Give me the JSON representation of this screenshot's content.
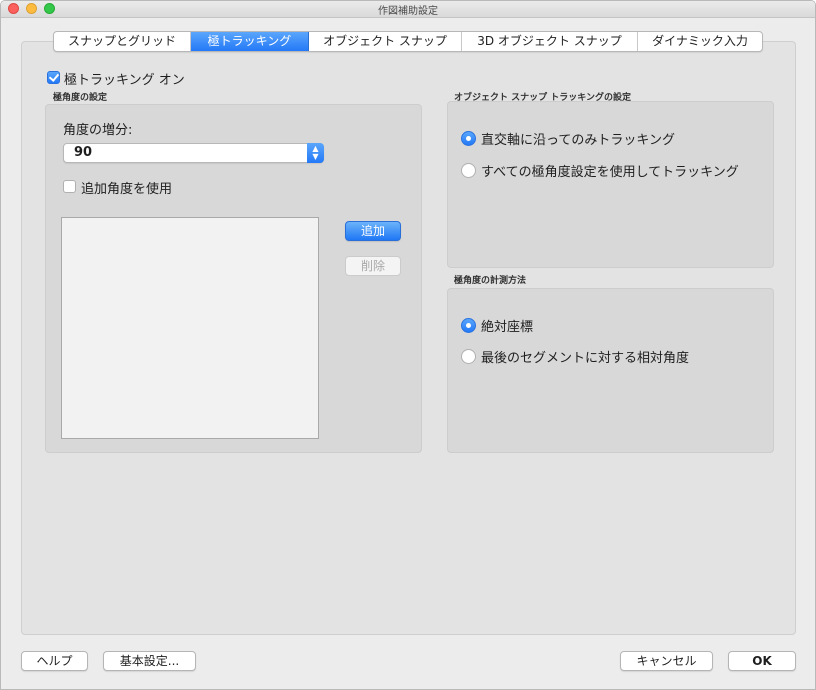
{
  "window": {
    "title": "作図補助設定"
  },
  "tabs": [
    {
      "label": "スナップとグリッド",
      "active": false
    },
    {
      "label": "極トラッキング",
      "active": true
    },
    {
      "label": "オブジェクト スナップ",
      "active": false
    },
    {
      "label": "3D オブジェクト スナップ",
      "active": false
    },
    {
      "label": "ダイナミック入力",
      "active": false
    }
  ],
  "polar": {
    "enable_label": "極トラッキング オン",
    "enabled": true,
    "angle_group_title": "極角度の設定",
    "increment_label": "角度の増分:",
    "increment_value": "90",
    "additional_label": "追加角度を使用",
    "additional_checked": false,
    "add_button": "追加",
    "delete_button": "削除"
  },
  "osnap_tracking": {
    "group_title": "オブジェクト スナップ トラッキングの設定",
    "option_orthogonal": "直交軸に沿ってのみトラッキング",
    "option_all": "すべての極角度設定を使用してトラッキング",
    "selected": "orthogonal"
  },
  "measurement": {
    "group_title": "極角度の計測方法",
    "option_absolute": "絶対座標",
    "option_relative": "最後のセグメントに対する相対角度",
    "selected": "absolute"
  },
  "footer": {
    "help": "ヘルプ",
    "options": "基本設定...",
    "cancel": "キャンセル",
    "ok": "OK"
  },
  "colors": {
    "accent": "#2479f7",
    "window_bg": "#ececec",
    "panel_bg": "#e3e3e3",
    "group_bg": "#d8d8d8"
  }
}
